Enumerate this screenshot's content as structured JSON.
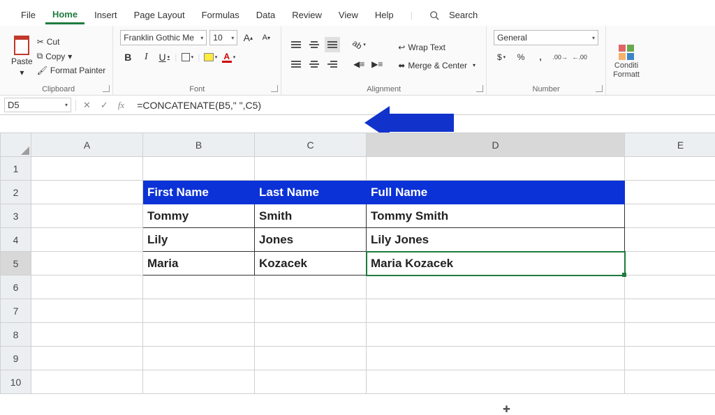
{
  "tabs": {
    "items": [
      "File",
      "Home",
      "Insert",
      "Page Layout",
      "Formulas",
      "Data",
      "Review",
      "View",
      "Help"
    ],
    "active": "Home",
    "search_label": "Search"
  },
  "ribbon": {
    "clipboard": {
      "paste": "Paste",
      "cut": "Cut",
      "copy": "Copy",
      "format_painter": "Format Painter",
      "group": "Clipboard"
    },
    "font": {
      "font_name": "Franklin Gothic Me",
      "font_size": "10",
      "group": "Font"
    },
    "alignment": {
      "wrap": "Wrap Text",
      "merge": "Merge & Center",
      "group": "Alignment"
    },
    "number": {
      "format": "General",
      "group": "Number"
    },
    "conditional": {
      "line1": "Conditi",
      "line2": "Formatt"
    }
  },
  "formula_bar": {
    "cell_ref": "D5",
    "formula": "=CONCATENATE(B5,\" \",C5)"
  },
  "columns": [
    "A",
    "B",
    "C",
    "D",
    "E"
  ],
  "row_numbers": [
    "1",
    "2",
    "3",
    "4",
    "5",
    "6",
    "7",
    "8",
    "9",
    "10"
  ],
  "table": {
    "headers": {
      "b": "First Name",
      "c": "Last Name",
      "d": "Full Name"
    },
    "rows": [
      {
        "b": "Tommy",
        "c": "Smith",
        "d": "Tommy Smith"
      },
      {
        "b": "Lily",
        "c": "Jones",
        "d": "Lily  Jones"
      },
      {
        "b": "Maria",
        "c": "Kozacek",
        "d": "Maria Kozacek"
      }
    ]
  }
}
